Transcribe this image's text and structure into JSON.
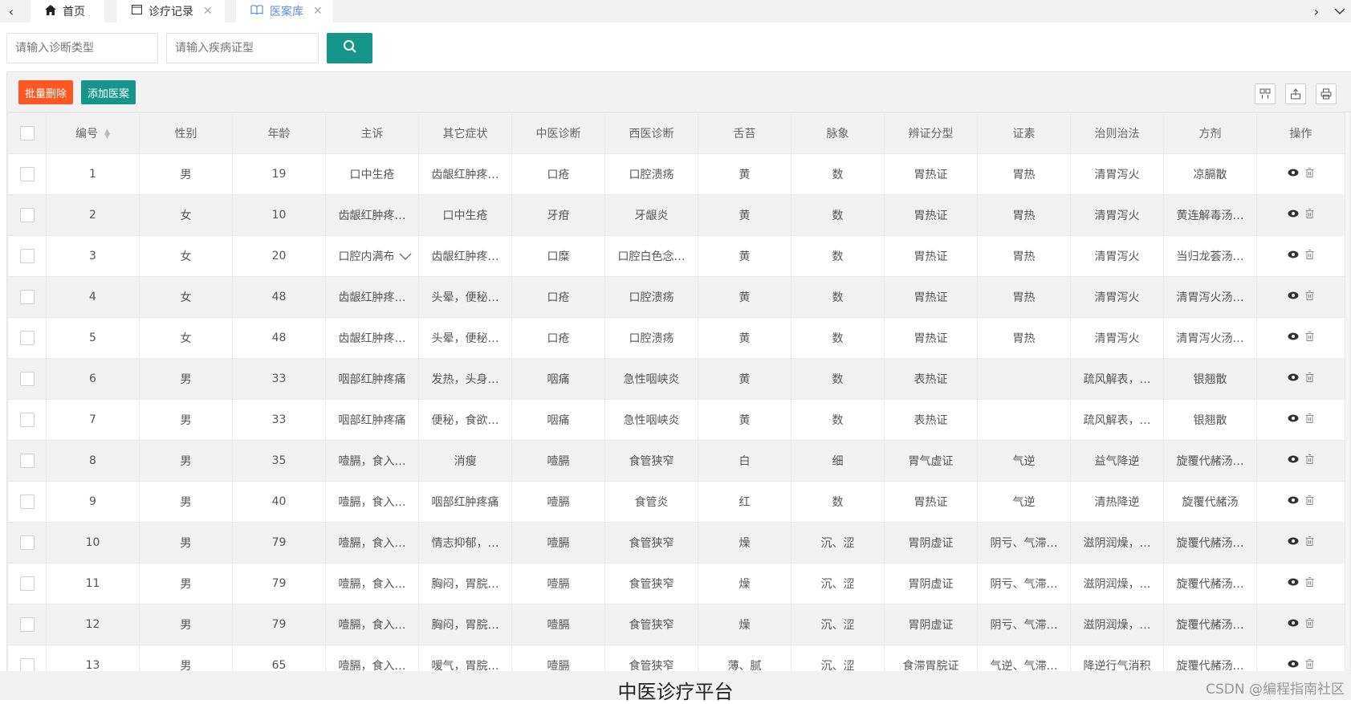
{
  "tabs": [
    {
      "label": "首页",
      "icon": "home-icon",
      "closable": false,
      "active": false
    },
    {
      "label": "诊疗记录",
      "icon": "window-icon",
      "closable": true,
      "active": false
    },
    {
      "label": "医案库",
      "icon": "book-icon",
      "closable": true,
      "active": true
    }
  ],
  "search": {
    "diagnosis_type_placeholder": "请输入诊断类型",
    "syndrome_type_placeholder": "请输入疾病证型"
  },
  "toolbar": {
    "batch_delete_label": "批量删除",
    "add_case_label": "添加医案"
  },
  "colors": {
    "primary": "#16968a",
    "danger": "#ff5722",
    "active_tab": "#5b8fd6"
  },
  "table": {
    "columns": [
      "编号",
      "性别",
      "年龄",
      "主诉",
      "其它症状",
      "中医诊断",
      "西医诊断",
      "舌苔",
      "脉象",
      "辨证分型",
      "证素",
      "治则治法",
      "方剂",
      "操作"
    ],
    "rows": [
      [
        "1",
        "男",
        "19",
        "口中生疮",
        "齿龈红肿疼…",
        "口疮",
        "口腔溃疡",
        "黄",
        "数",
        "胃热证",
        "胃热",
        "清胃泻火",
        "凉膈散"
      ],
      [
        "2",
        "女",
        "10",
        "齿龈红肿疼…",
        "口中生疮",
        "牙疳",
        "牙龈炎",
        "黄",
        "数",
        "胃热证",
        "胃热",
        "清胃泻火",
        "黄连解毒汤…"
      ],
      [
        "3",
        "女",
        "20",
        "口腔内满布…",
        "齿龈红肿疼…",
        "口糜",
        "口腔白色念…",
        "黄",
        "数",
        "胃热证",
        "胃热",
        "清胃泻火",
        "当归龙荟汤…"
      ],
      [
        "4",
        "女",
        "48",
        "齿龈红肿疼…",
        "头晕，便秘…",
        "口疮",
        "口腔溃疡",
        "黄",
        "数",
        "胃热证",
        "胃热",
        "清胃泻火",
        "清胃泻火汤…"
      ],
      [
        "5",
        "女",
        "48",
        "齿龈红肿疼…",
        "头晕，便秘…",
        "口疮",
        "口腔溃疡",
        "黄",
        "数",
        "胃热证",
        "胃热",
        "清胃泻火",
        "清胃泻火汤…"
      ],
      [
        "6",
        "男",
        "33",
        "咽部红肿疼痛",
        "发热，头身…",
        "咽痛",
        "急性咽峡炎",
        "黄",
        "数",
        "表热证",
        "",
        "疏风解表，…",
        "银翘散"
      ],
      [
        "7",
        "男",
        "33",
        "咽部红肿疼痛",
        "便秘，食欲…",
        "咽痛",
        "急性咽峡炎",
        "黄",
        "数",
        "表热证",
        "",
        "疏风解表，…",
        "银翘散"
      ],
      [
        "8",
        "男",
        "35",
        "噎膈，食入…",
        "消瘦",
        "噎膈",
        "食管狭窄",
        "白",
        "细",
        "胃气虚证",
        "气逆",
        "益气降逆",
        "旋覆代赭汤…"
      ],
      [
        "9",
        "男",
        "40",
        "噎膈，食入…",
        "咽部红肿疼痛",
        "噎膈",
        "食管炎",
        "红",
        "数",
        "胃热证",
        "气逆",
        "清热降逆",
        "旋覆代赭汤"
      ],
      [
        "10",
        "男",
        "79",
        "噎膈，食入…",
        "情志抑郁，…",
        "噎膈",
        "食管狭窄",
        "燥",
        "沉、涩",
        "胃阴虚证",
        "阴亏、气滞…",
        "滋阴润燥，…",
        "旋覆代赭汤…"
      ],
      [
        "11",
        "男",
        "79",
        "噎膈，食入…",
        "胸闷，胃脘…",
        "噎膈",
        "食管狭窄",
        "燥",
        "沉、涩",
        "胃阴虚证",
        "阴亏、气滞…",
        "滋阴润燥，…",
        "旋覆代赭汤…"
      ],
      [
        "12",
        "男",
        "79",
        "噎膈，食入…",
        "胸闷，胃脘…",
        "噎膈",
        "食管狭窄",
        "燥",
        "沉、涩",
        "胃阴虚证",
        "阴亏、气滞…",
        "滋阴润燥，…",
        "旋覆代赭汤…"
      ],
      [
        "13",
        "男",
        "65",
        "噎膈，食入…",
        "嗳气，胃脘…",
        "噎膈",
        "食管狭窄",
        "薄、腻",
        "沉、涩",
        "食滞胃脘证",
        "气逆、气滞…",
        "降逆行气消积",
        "旋覆代赭汤…"
      ]
    ]
  },
  "footer": {
    "title": "中医诊疗平台",
    "watermark": "CSDN @编程指南社区"
  }
}
